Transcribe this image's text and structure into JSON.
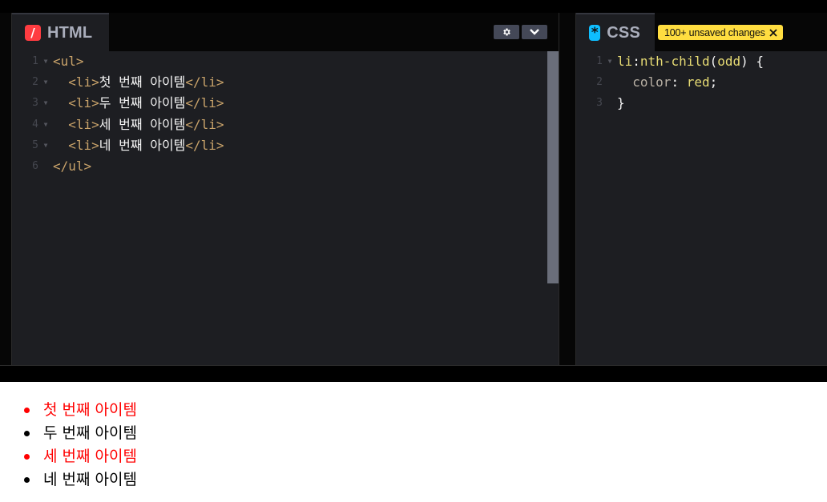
{
  "html_editor": {
    "title": "HTML",
    "icon": "/",
    "settings_icon": "gear-icon",
    "collapse_icon": "chevron-down-icon",
    "lines": [
      {
        "num": "1",
        "foldable": true,
        "tokens": [
          {
            "t": "tag",
            "v": "<ul>"
          }
        ]
      },
      {
        "num": "2",
        "foldable": true,
        "tokens": [
          {
            "t": "text",
            "v": "  "
          },
          {
            "t": "tag",
            "v": "<li>"
          },
          {
            "t": "text",
            "v": "첫 번째 아이템"
          },
          {
            "t": "tag",
            "v": "</li>"
          }
        ]
      },
      {
        "num": "3",
        "foldable": true,
        "tokens": [
          {
            "t": "text",
            "v": "  "
          },
          {
            "t": "tag",
            "v": "<li>"
          },
          {
            "t": "text",
            "v": "두 번째 아이템"
          },
          {
            "t": "tag",
            "v": "</li>"
          }
        ]
      },
      {
        "num": "4",
        "foldable": true,
        "tokens": [
          {
            "t": "text",
            "v": "  "
          },
          {
            "t": "tag",
            "v": "<li>"
          },
          {
            "t": "text",
            "v": "세 번째 아이템"
          },
          {
            "t": "tag",
            "v": "</li>"
          }
        ]
      },
      {
        "num": "5",
        "foldable": true,
        "tokens": [
          {
            "t": "text",
            "v": "  "
          },
          {
            "t": "tag",
            "v": "<li>"
          },
          {
            "t": "text",
            "v": "네 번째 아이템"
          },
          {
            "t": "tag",
            "v": "</li>"
          }
        ]
      },
      {
        "num": "6",
        "foldable": false,
        "tokens": [
          {
            "t": "tag",
            "v": "</ul>"
          }
        ]
      }
    ]
  },
  "css_editor": {
    "title": "CSS",
    "icon": "*",
    "unsaved_badge": "100+ unsaved changes",
    "badge_close_icon": "close-icon",
    "lines": [
      {
        "num": "1",
        "foldable": true,
        "tokens": [
          {
            "t": "sel",
            "v": "li"
          },
          {
            "t": "punct",
            "v": ":"
          },
          {
            "t": "pseudo",
            "v": "nth-child"
          },
          {
            "t": "punct",
            "v": "("
          },
          {
            "t": "pseudo",
            "v": "odd"
          },
          {
            "t": "punct",
            "v": ") {"
          }
        ]
      },
      {
        "num": "2",
        "foldable": false,
        "tokens": [
          {
            "t": "text",
            "v": "  "
          },
          {
            "t": "prop",
            "v": "color"
          },
          {
            "t": "punct",
            "v": ": "
          },
          {
            "t": "val",
            "v": "red"
          },
          {
            "t": "punct",
            "v": ";"
          }
        ]
      },
      {
        "num": "3",
        "foldable": false,
        "tokens": [
          {
            "t": "punct",
            "v": "}"
          }
        ]
      }
    ]
  },
  "preview": {
    "items": [
      {
        "text": "첫 번째 아이템",
        "color": "#ff0000"
      },
      {
        "text": "두 번째 아이템",
        "color": "#000000"
      },
      {
        "text": "세 번째 아이템",
        "color": "#ff0000"
      },
      {
        "text": "네 번째 아이템",
        "color": "#000000"
      }
    ]
  },
  "colors": {
    "html_accent": "#ff3c41",
    "css_accent": "#0ebeff",
    "badge_bg": "#ffdd40",
    "editor_bg": "#1d1e22"
  }
}
